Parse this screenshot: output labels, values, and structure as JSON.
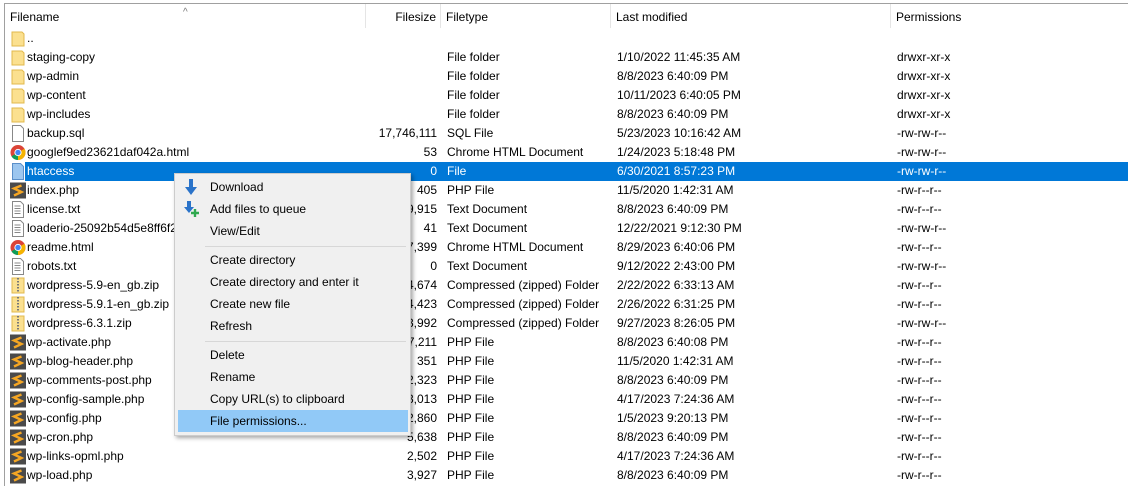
{
  "columns": {
    "filename": "Filename",
    "filesize": "Filesize",
    "filetype": "Filetype",
    "modified": "Last modified",
    "permissions": "Permissions"
  },
  "rows": [
    {
      "name": "..",
      "size": "",
      "type": "",
      "modified": "",
      "perm": "",
      "icon": "folder"
    },
    {
      "name": "staging-copy",
      "size": "",
      "type": "File folder",
      "modified": "1/10/2022 11:45:35 AM",
      "perm": "drwxr-xr-x",
      "icon": "folder"
    },
    {
      "name": "wp-admin",
      "size": "",
      "type": "File folder",
      "modified": "8/8/2023 6:40:09 PM",
      "perm": "drwxr-xr-x",
      "icon": "folder"
    },
    {
      "name": "wp-content",
      "size": "",
      "type": "File folder",
      "modified": "10/11/2023 6:40:05 PM",
      "perm": "drwxr-xr-x",
      "icon": "folder"
    },
    {
      "name": "wp-includes",
      "size": "",
      "type": "File folder",
      "modified": "8/8/2023 6:40:09 PM",
      "perm": "drwxr-xr-x",
      "icon": "folder"
    },
    {
      "name": "backup.sql",
      "size": "17,746,111",
      "type": "SQL File",
      "modified": "5/23/2023 10:16:42 AM",
      "perm": "-rw-rw-r--",
      "icon": "file"
    },
    {
      "name": "googlef9ed23621daf042a.html",
      "size": "53",
      "type": "Chrome HTML Document",
      "modified": "1/24/2023 5:18:48 PM",
      "perm": "-rw-rw-r--",
      "icon": "chrome"
    },
    {
      "name": "htaccess",
      "size": "0",
      "type": "File",
      "modified": "6/30/2021 8:57:23 PM",
      "perm": "-rw-rw-r--",
      "icon": "blankfile",
      "selected": true
    },
    {
      "name": "index.php",
      "size": "405",
      "type": "PHP File",
      "modified": "11/5/2020 1:42:31 AM",
      "perm": "-rw-r--r--",
      "icon": "php"
    },
    {
      "name": "license.txt",
      "size": "9,915",
      "type": "Text Document",
      "modified": "8/8/2023 6:40:09 PM",
      "perm": "-rw-r--r--",
      "icon": "text"
    },
    {
      "name": "loaderio-25092b54d5e8ff6f2",
      "size": "41",
      "type": "Text Document",
      "modified": "12/22/2021 9:12:30 PM",
      "perm": "-rw-rw-r--",
      "icon": "text"
    },
    {
      "name": "readme.html",
      "size": "7,399",
      "type": "Chrome HTML Document",
      "modified": "8/29/2023 6:40:06 PM",
      "perm": "-rw-r--r--",
      "icon": "chrome"
    },
    {
      "name": "robots.txt",
      "size": "0",
      "type": "Text Document",
      "modified": "9/12/2022 2:43:00 PM",
      "perm": "-rw-rw-r--",
      "icon": "text"
    },
    {
      "name": "wordpress-5.9-en_gb.zip",
      "size": "4,674",
      "type": "Compressed (zipped) Folder",
      "modified": "2/22/2022 6:33:13 AM",
      "perm": "-rw-r--r--",
      "icon": "zip"
    },
    {
      "name": "wordpress-5.9.1-en_gb.zip",
      "size": "4,423",
      "type": "Compressed (zipped) Folder",
      "modified": "2/26/2022 6:31:25 PM",
      "perm": "-rw-r--r--",
      "icon": "zip"
    },
    {
      "name": "wordpress-6.3.1.zip",
      "size": "3,992",
      "type": "Compressed (zipped) Folder",
      "modified": "9/27/2023 8:26:05 PM",
      "perm": "-rw-rw-r--",
      "icon": "zip"
    },
    {
      "name": "wp-activate.php",
      "size": "7,211",
      "type": "PHP File",
      "modified": "8/8/2023 6:40:08 PM",
      "perm": "-rw-r--r--",
      "icon": "php"
    },
    {
      "name": "wp-blog-header.php",
      "size": "351",
      "type": "PHP File",
      "modified": "11/5/2020 1:42:31 AM",
      "perm": "-rw-r--r--",
      "icon": "php"
    },
    {
      "name": "wp-comments-post.php",
      "size": "2,323",
      "type": "PHP File",
      "modified": "8/8/2023 6:40:09 PM",
      "perm": "-rw-r--r--",
      "icon": "php"
    },
    {
      "name": "wp-config-sample.php",
      "size": "3,013",
      "type": "PHP File",
      "modified": "4/17/2023 7:24:36 AM",
      "perm": "-rw-r--r--",
      "icon": "php"
    },
    {
      "name": "wp-config.php",
      "size": "2,860",
      "type": "PHP File",
      "modified": "1/5/2023 9:20:13 PM",
      "perm": "-rw-r--r--",
      "icon": "php"
    },
    {
      "name": "wp-cron.php",
      "size": "5,638",
      "type": "PHP File",
      "modified": "8/8/2023 6:40:09 PM",
      "perm": "-rw-r--r--",
      "icon": "php"
    },
    {
      "name": "wp-links-opml.php",
      "size": "2,502",
      "type": "PHP File",
      "modified": "4/17/2023 7:24:36 AM",
      "perm": "-rw-r--r--",
      "icon": "php"
    },
    {
      "name": "wp-load.php",
      "size": "3,927",
      "type": "PHP File",
      "modified": "8/8/2023 6:40:09 PM",
      "perm": "-rw-r--r--",
      "icon": "php"
    }
  ],
  "menu": {
    "groups": [
      [
        {
          "label": "Download",
          "icon": "download-icon"
        },
        {
          "label": "Add files to queue",
          "icon": "add-to-queue-icon"
        },
        {
          "label": "View/Edit"
        }
      ],
      [
        {
          "label": "Create directory"
        },
        {
          "label": "Create directory and enter it"
        },
        {
          "label": "Create new file"
        },
        {
          "label": "Refresh"
        }
      ],
      [
        {
          "label": "Delete"
        },
        {
          "label": "Rename"
        },
        {
          "label": "Copy URL(s) to clipboard"
        },
        {
          "label": "File permissions...",
          "highlighted": true
        }
      ]
    ]
  },
  "colors": {
    "selection": "#0078d7",
    "menu_highlight": "#91c9f7"
  }
}
